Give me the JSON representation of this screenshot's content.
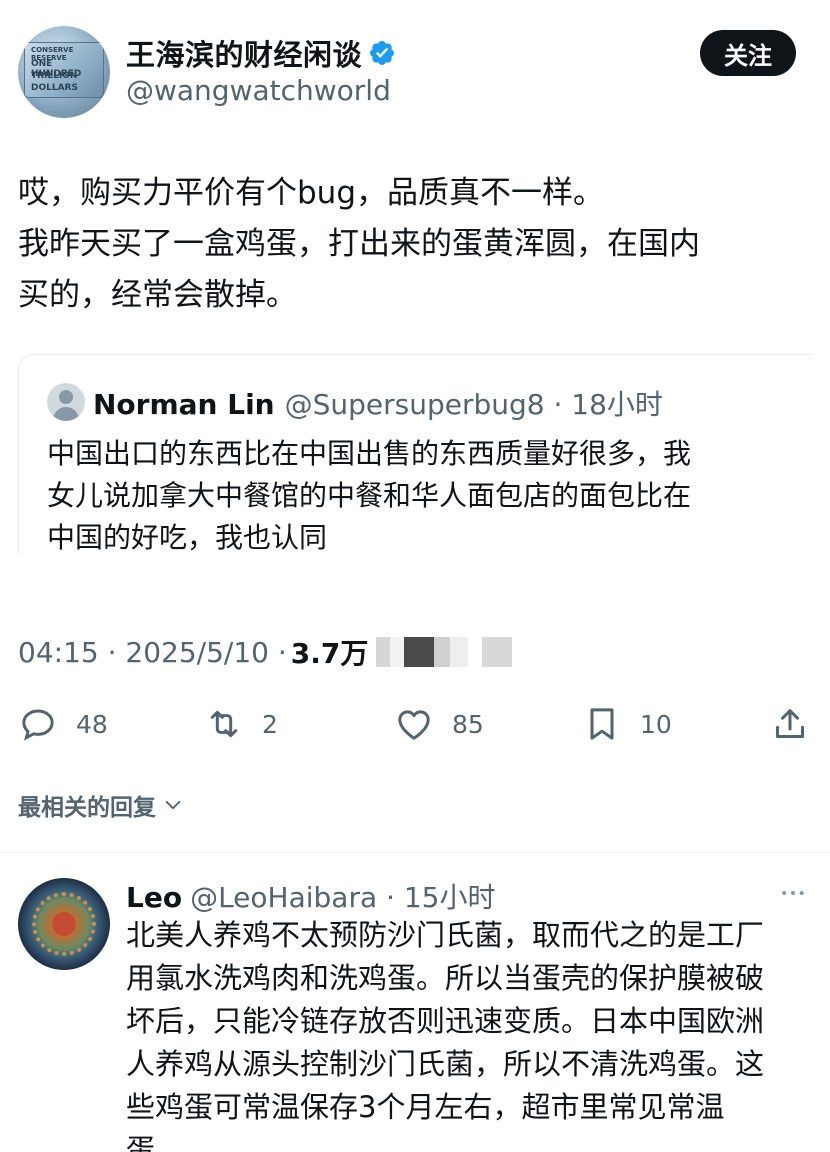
{
  "author": {
    "display_name": "王海滨的财经闲谈",
    "handle": "@wangwatchworld",
    "avatar_text": [
      "CONSERVE RESERVE",
      "ONE HUNDRED",
      "TRILLION",
      "DOLLARS"
    ]
  },
  "follow_label": "关注",
  "tweet": {
    "lines": [
      "哎，购买力平价有个bug，品质真不一样。",
      "我昨天买了一盒鸡蛋，打出来的蛋黄浑圆，在国内",
      "买的，经常会散掉。"
    ]
  },
  "quote": {
    "name": "Norman Lin",
    "meta": "@Supersuperbug8 · 18小时",
    "lines": [
      "中国出口的东西比在中国出售的东西质量好很多，我",
      "女儿说加拿大中餐馆的中餐和华人面包店的面包比在",
      "中国的好吃，我也认同"
    ]
  },
  "meta": {
    "time_date": "04:15 · 2025/5/10 · ",
    "views": "3.7万"
  },
  "actions": {
    "reply_count": "48",
    "retweet_count": "2",
    "like_count": "85",
    "bookmark_count": "10"
  },
  "sort_label": "最相关的回复",
  "reply": {
    "name": "Leo",
    "meta": "@LeoHaibara · 15小时",
    "lines": [
      "北美人养鸡不太预防沙门氏菌，取而代之的是工厂",
      "用氯水洗鸡肉和洗鸡蛋。所以当蛋壳的保护膜被破",
      "坏后，只能冷链存放否则迅速变质。日本中国欧洲",
      "人养鸡从源头控制沙门氏菌，所以不清洗鸡蛋。这",
      "些鸡蛋可常温保存3个月左右，超市里常见常温",
      "蛋。"
    ]
  },
  "colors": {
    "text": "#0f1419",
    "secondary": "#536471",
    "verified": "#1d9bf0",
    "follow_bg": "#0f1419"
  },
  "icons": [
    "verified-badge-icon",
    "reply-icon",
    "retweet-icon",
    "like-icon",
    "bookmark-icon",
    "share-icon",
    "chevron-down-icon",
    "more-icon",
    "default-avatar-icon"
  ]
}
